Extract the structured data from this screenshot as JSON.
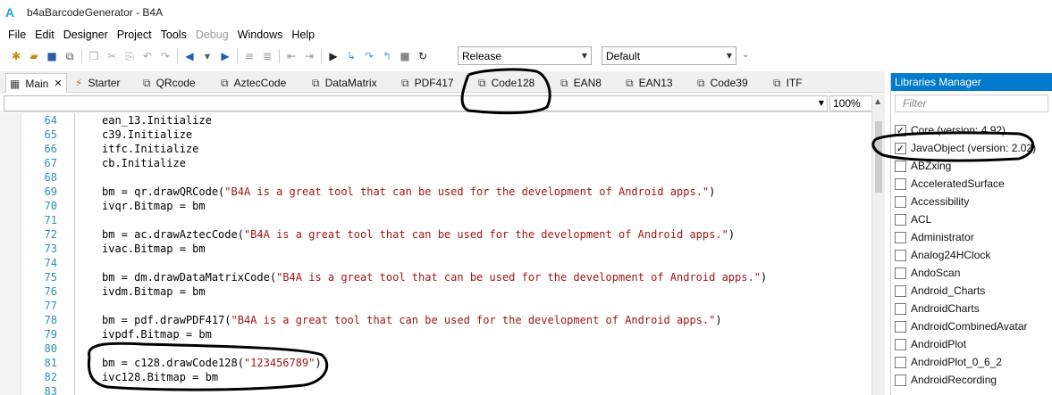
{
  "window": {
    "title": "b4aBarcodeGenerator - B4A",
    "logo": "A"
  },
  "menu": [
    "File",
    "Edit",
    "Designer",
    "Project",
    "Tools",
    "Debug",
    "Windows",
    "Help"
  ],
  "menu_disabled": [
    "Debug"
  ],
  "toolbar": {
    "build_config": "Release",
    "device_config": "Default"
  },
  "tabs": [
    {
      "label": "Main",
      "icon": "table-icon",
      "active": true,
      "closable": true
    },
    {
      "label": "Starter",
      "icon": "starter-icon"
    },
    {
      "label": "QRcode",
      "icon": "module-icon"
    },
    {
      "label": "AztecCode",
      "icon": "module-icon"
    },
    {
      "label": "DataMatrix",
      "icon": "module-icon"
    },
    {
      "label": "PDF417",
      "icon": "module-icon"
    },
    {
      "label": "Code128",
      "icon": "module-icon"
    },
    {
      "label": "EAN8",
      "icon": "module-icon"
    },
    {
      "label": "EAN13",
      "icon": "module-icon"
    },
    {
      "label": "Code39",
      "icon": "module-icon"
    },
    {
      "label": "ITF",
      "icon": "module-icon"
    }
  ],
  "editor": {
    "zoom": "100%",
    "lines": [
      {
        "n": "64",
        "code": "ean_13.Initialize",
        "str": "",
        "after": ""
      },
      {
        "n": "65",
        "code": "c39.Initialize",
        "str": "",
        "after": ""
      },
      {
        "n": "66",
        "code": "itfc.Initialize",
        "str": "",
        "after": ""
      },
      {
        "n": "67",
        "code": "cb.Initialize",
        "str": "",
        "after": ""
      },
      {
        "n": "68",
        "code": "",
        "str": "",
        "after": ""
      },
      {
        "n": "69",
        "code": "bm = qr.drawQRCode(",
        "str": "\"B4A is a great tool that can be used for the development of Android apps.\"",
        "after": ")"
      },
      {
        "n": "70",
        "code": "ivqr.Bitmap = bm",
        "str": "",
        "after": ""
      },
      {
        "n": "71",
        "code": "",
        "str": "",
        "after": ""
      },
      {
        "n": "72",
        "code": "bm = ac.drawAztecCode(",
        "str": "\"B4A is a great tool that can be used for the development of Android apps.\"",
        "after": ")"
      },
      {
        "n": "73",
        "code": "ivac.Bitmap = bm",
        "str": "",
        "after": ""
      },
      {
        "n": "74",
        "code": "",
        "str": "",
        "after": ""
      },
      {
        "n": "75",
        "code": "bm = dm.drawDataMatrixCode(",
        "str": "\"B4A is a great tool that can be used for the development of Android apps.\"",
        "after": ")"
      },
      {
        "n": "76",
        "code": "ivdm.Bitmap = bm",
        "str": "",
        "after": ""
      },
      {
        "n": "77",
        "code": "",
        "str": "",
        "after": ""
      },
      {
        "n": "78",
        "code": "bm = pdf.drawPDF417(",
        "str": "\"B4A is a great tool that can be used for the development of Android apps.\"",
        "after": ")"
      },
      {
        "n": "79",
        "code": "ivpdf.Bitmap = bm",
        "str": "",
        "after": ""
      },
      {
        "n": "80",
        "code": "",
        "str": "",
        "after": ""
      },
      {
        "n": "81",
        "code": "bm = c128.drawCode128(",
        "str": "\"123456789\"",
        "after": ")"
      },
      {
        "n": "82",
        "code": "ivc128.Bitmap = bm",
        "str": "",
        "after": ""
      },
      {
        "n": "83",
        "code": "",
        "str": "",
        "after": ""
      }
    ]
  },
  "libraries": {
    "title": "Libraries Manager",
    "filter_placeholder": "Filter",
    "items": [
      {
        "label": "Core (version: 4.92)",
        "checked": true
      },
      {
        "label": "JavaObject (version: 2.02)",
        "checked": true
      },
      {
        "label": "ABZxing",
        "checked": false
      },
      {
        "label": "AcceleratedSurface",
        "checked": false
      },
      {
        "label": "Accessibility",
        "checked": false
      },
      {
        "label": "ACL",
        "checked": false
      },
      {
        "label": "Administrator",
        "checked": false
      },
      {
        "label": "Analog24HClock",
        "checked": false
      },
      {
        "label": "AndoScan",
        "checked": false
      },
      {
        "label": "Android_Charts",
        "checked": false
      },
      {
        "label": "AndroidCharts",
        "checked": false
      },
      {
        "label": "AndroidCombinedAvatar",
        "checked": false
      },
      {
        "label": "AndroidPlot",
        "checked": false
      },
      {
        "label": "AndroidPlot_0_6_2",
        "checked": false
      },
      {
        "label": "AndroidRecording",
        "checked": false
      }
    ]
  },
  "colors": {
    "accent": "#007acc",
    "line_number": "#2b91af",
    "string": "#a31515"
  }
}
